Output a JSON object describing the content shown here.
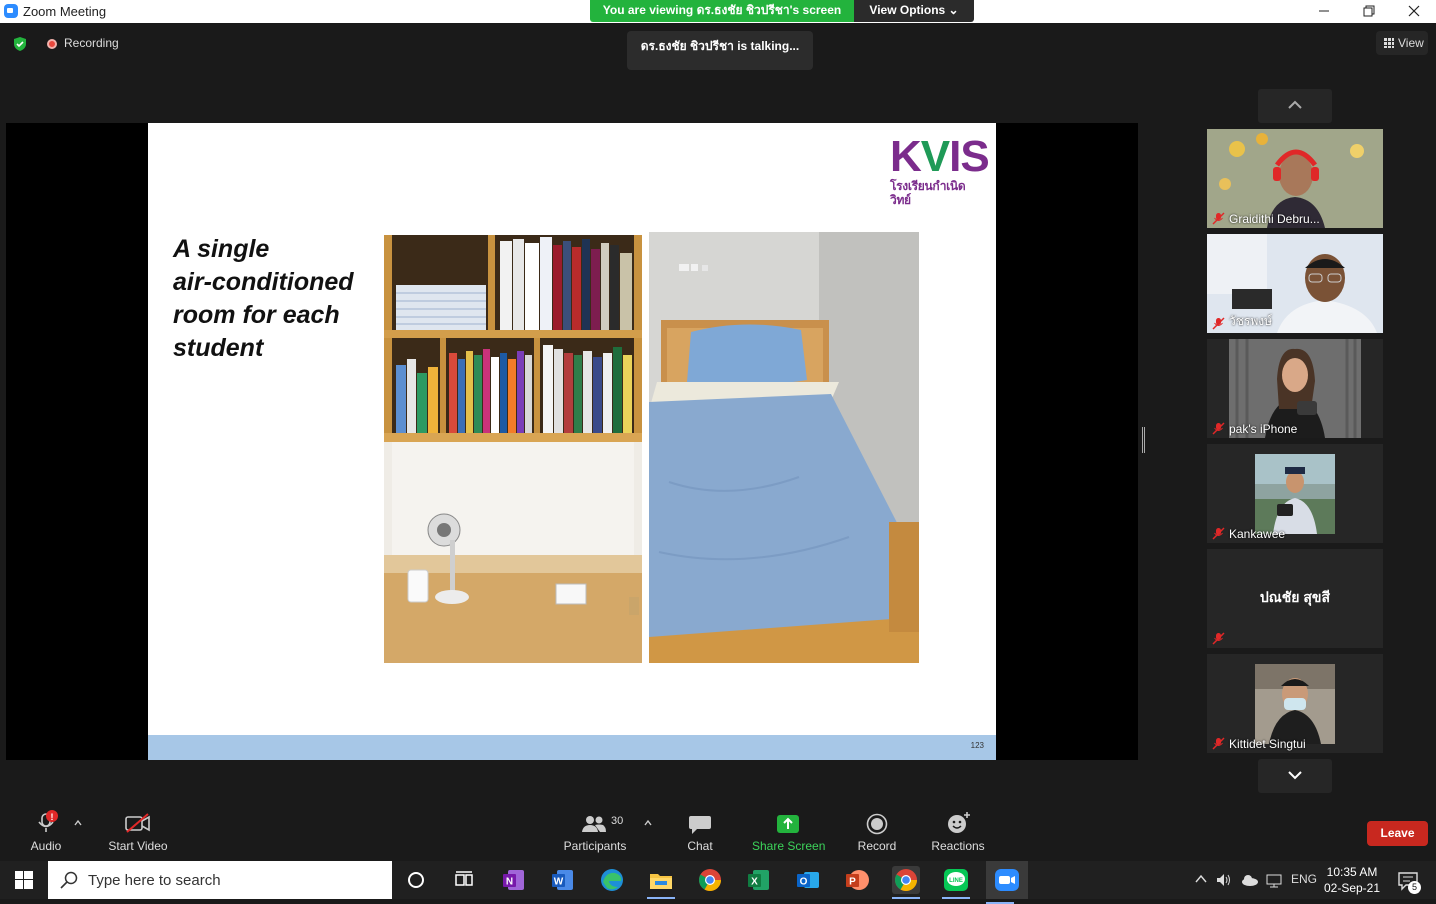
{
  "window": {
    "title": "Zoom Meeting",
    "minimize_icon": "minimize-icon",
    "maximize_icon": "restore-icon",
    "close_icon": "close-icon"
  },
  "banner": {
    "viewing_text": "You are viewing ดร.ธงชัย ชิวปรีชา's screen",
    "view_options_label": "View Options ⌄"
  },
  "meeting_bar": {
    "recording_label": "Recording",
    "talking_text": "ดร.ธงชัย ชิวปรีชา is  talking...",
    "view_label": "View",
    "colors": {
      "security": "#23b33d",
      "recording": "#e8483d"
    }
  },
  "slide": {
    "heading_lines": [
      "A single",
      "air-conditioned",
      "room for each",
      "student"
    ],
    "logo_text": "KVIS",
    "logo_subtext": "โรงเรียนกำเนิดวิทย์",
    "page_number": "123",
    "colors": {
      "logo_purple": "#7b2c8c",
      "logo_green": "#1f9a57",
      "footer": "#a7c7e7"
    }
  },
  "gallery": {
    "participants": [
      {
        "name": "Graidithi Debru...",
        "muted": true,
        "video": true
      },
      {
        "name": "วัชรพงษ์",
        "muted": true,
        "video": true
      },
      {
        "name": "pak's iPhone",
        "muted": true,
        "video": true
      },
      {
        "name": "Kankawee",
        "muted": true,
        "video": true
      },
      {
        "name": "",
        "display_name": "ปณชัย สุขสี",
        "muted": true,
        "video": false
      },
      {
        "name": "Kittidet Singtui",
        "muted": true,
        "video": true
      }
    ]
  },
  "toolbar": {
    "audio_label": "Audio",
    "video_label": "Start Video",
    "participants_label": "Participants",
    "participants_count": "30",
    "chat_label": "Chat",
    "share_label": "Share Screen",
    "record_label": "Record",
    "reactions_label": "Reactions",
    "leave_label": "Leave",
    "colors": {
      "share": "#23b33d",
      "leave": "#c8281f",
      "alert": "#e02828"
    }
  },
  "taskbar": {
    "search_placeholder": "Type here to search",
    "apps": [
      "cortana-icon",
      "task-view-icon",
      "onenote-icon",
      "word-icon",
      "edge-icon",
      "file-explorer-icon",
      "chrome-icon",
      "excel-icon",
      "outlook-icon",
      "powerpoint-icon",
      "chrome-icon",
      "line-icon",
      "zoom-icon"
    ],
    "language": "ENG",
    "time": "10:35 AM",
    "date": "02-Sep-21",
    "notification_count": "5"
  }
}
